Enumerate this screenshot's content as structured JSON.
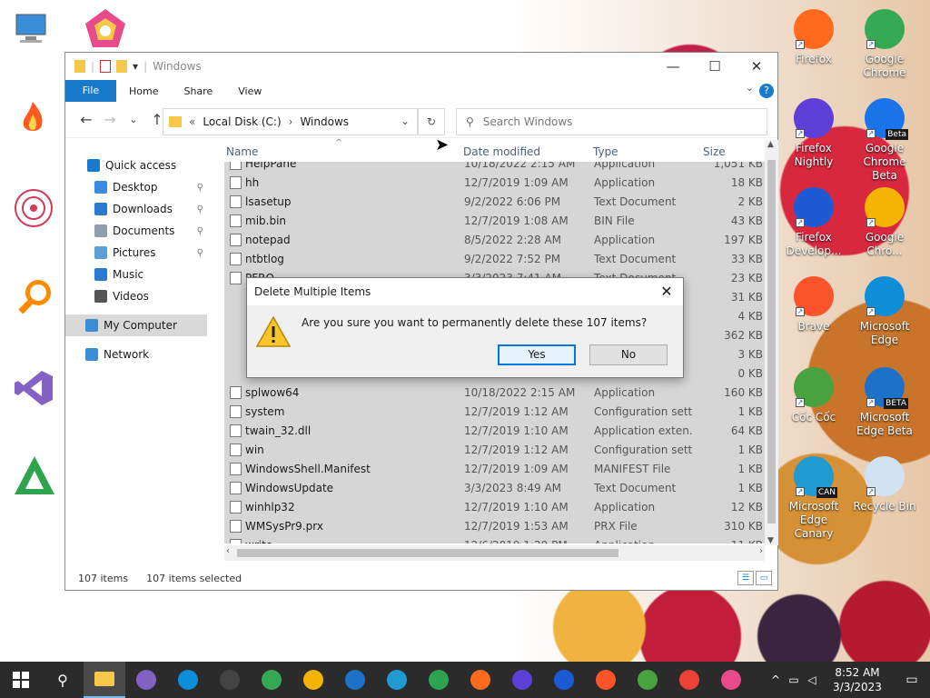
{
  "desktop": {
    "right_icons": [
      {
        "label": "Firefox",
        "color": "#ff6a1f"
      },
      {
        "label": "Google Chrome",
        "color": "#34a853"
      },
      {
        "label": "Firefox Nightly",
        "color": "#5b3fd6"
      },
      {
        "label": "Google Chrome Beta",
        "color": "#1a73e8",
        "badge": "Beta"
      },
      {
        "label": "Firefox Develop...",
        "color": "#1d5bd6"
      },
      {
        "label": "Google Chro...",
        "color": "#f5b400"
      },
      {
        "label": "Brave",
        "color": "#fb542b"
      },
      {
        "label": "Microsoft Edge",
        "color": "#0c8fd8"
      },
      {
        "label": "Cốc Cốc",
        "color": "#47a23f"
      },
      {
        "label": "Microsoft Edge Beta",
        "color": "#1c72c9",
        "badge": "BETA"
      },
      {
        "label": "Microsoft Edge Canary",
        "color": "#1f9bd1",
        "badge": "CAN"
      },
      {
        "label": "Recycle Bin",
        "color": "#cfe3f5"
      }
    ]
  },
  "explorer": {
    "title": "Windows",
    "ribbon": {
      "file": "File",
      "tabs": [
        "Home",
        "Share",
        "View"
      ],
      "help": "?"
    },
    "address": {
      "prefix": "«",
      "parts": [
        "Local Disk (C:)",
        "Windows"
      ]
    },
    "search_placeholder": "Search Windows",
    "nav": [
      {
        "label": "Quick access",
        "color": "#1979ca",
        "pinned": false
      },
      {
        "label": "Desktop",
        "color": "#3b8be0",
        "pinned": true
      },
      {
        "label": "Downloads",
        "color": "#2a7ad0",
        "pinned": true
      },
      {
        "label": "Documents",
        "color": "#8f9db0",
        "pinned": true
      },
      {
        "label": "Pictures",
        "color": "#5aa0d8",
        "pinned": true
      },
      {
        "label": "Music",
        "color": "#2a7ad0",
        "pinned": false
      },
      {
        "label": "Videos",
        "color": "#555555",
        "pinned": false
      },
      {
        "label": "My Computer",
        "color": "#3a8ed8",
        "pinned": false
      },
      {
        "label": "Network",
        "color": "#3a8ed8",
        "pinned": false
      }
    ],
    "columns": {
      "name": "Name",
      "date": "Date modified",
      "type": "Type",
      "size": "Size"
    },
    "files": [
      {
        "name": "HelpPane",
        "date": "10/18/2022 2:15 AM",
        "type": "Application",
        "size": "1,051 KB"
      },
      {
        "name": "hh",
        "date": "12/7/2019 1:09 AM",
        "type": "Application",
        "size": "18 KB"
      },
      {
        "name": "lsasetup",
        "date": "9/2/2022 6:06 PM",
        "type": "Text Document",
        "size": "2 KB"
      },
      {
        "name": "mib.bin",
        "date": "12/7/2019 1:08 AM",
        "type": "BIN File",
        "size": "43 KB"
      },
      {
        "name": "notepad",
        "date": "8/5/2022 2:28 AM",
        "type": "Application",
        "size": "197 KB"
      },
      {
        "name": "ntbtlog",
        "date": "9/2/2022 7:52 PM",
        "type": "Text Document",
        "size": "33 KB"
      },
      {
        "name": "PFRO",
        "date": "3/3/2023 7:41 AM",
        "type": "Text Document",
        "size": "23 KB"
      },
      {
        "name": "",
        "date": "",
        "type": "",
        "size": "31 KB"
      },
      {
        "name": "",
        "date": "",
        "type": "",
        "size": "4 KB"
      },
      {
        "name": "",
        "date": "",
        "type": "",
        "size": "362 KB"
      },
      {
        "name": "",
        "date": "",
        "type": "",
        "size": "3 KB"
      },
      {
        "name": "",
        "date": "",
        "type": "",
        "size": "0 KB"
      },
      {
        "name": "splwow64",
        "date": "10/18/2022 2:15 AM",
        "type": "Application",
        "size": "160 KB"
      },
      {
        "name": "system",
        "date": "12/7/2019 1:12 AM",
        "type": "Configuration sett...",
        "size": "1 KB"
      },
      {
        "name": "twain_32.dll",
        "date": "12/7/2019 1:10 AM",
        "type": "Application exten...",
        "size": "64 KB"
      },
      {
        "name": "win",
        "date": "12/7/2019 1:12 AM",
        "type": "Configuration sett...",
        "size": "1 KB"
      },
      {
        "name": "WindowsShell.Manifest",
        "date": "12/7/2019 1:09 AM",
        "type": "MANIFEST File",
        "size": "1 KB"
      },
      {
        "name": "WindowsUpdate",
        "date": "3/3/2023 8:49 AM",
        "type": "Text Document",
        "size": "1 KB"
      },
      {
        "name": "winhlp32",
        "date": "12/7/2019 1:10 AM",
        "type": "Application",
        "size": "12 KB"
      },
      {
        "name": "WMSysPr9.prx",
        "date": "12/7/2019 1:53 AM",
        "type": "PRX File",
        "size": "310 KB"
      },
      {
        "name": "write",
        "date": "12/6/2019 1:29 PM",
        "type": "Application",
        "size": "11 KB"
      }
    ],
    "status": {
      "count": "107 items",
      "selected": "107 items selected"
    }
  },
  "dialog": {
    "title": "Delete Multiple Items",
    "message": "Are you sure you want to permanently delete these 107 items?",
    "yes": "Yes",
    "no": "No"
  },
  "taskbar": {
    "apps": [
      {
        "name": "file-explorer",
        "color": "#f5c84a",
        "active": true
      },
      {
        "name": "visual-studio",
        "color": "#8661c5",
        "active": false
      },
      {
        "name": "edge",
        "color": "#0c8fd8",
        "active": false
      },
      {
        "name": "obs",
        "color": "#444444",
        "active": false
      },
      {
        "name": "chrome-beta",
        "color": "#34a853",
        "active": false
      },
      {
        "name": "chrome-canary",
        "color": "#f5b400",
        "active": false
      },
      {
        "name": "edge-beta",
        "color": "#1c72c9",
        "active": false
      },
      {
        "name": "edge-canary",
        "color": "#1f9bd1",
        "active": false
      },
      {
        "name": "pdf-app",
        "color": "#2ea44f",
        "active": false
      },
      {
        "name": "firefox",
        "color": "#ff6a1f",
        "active": false
      },
      {
        "name": "firefox-nightly",
        "color": "#5b3fd6",
        "active": false
      },
      {
        "name": "firefox-dev",
        "color": "#1d5bd6",
        "active": false
      },
      {
        "name": "brave",
        "color": "#fb542b",
        "active": false
      },
      {
        "name": "coccoc",
        "color": "#47a23f",
        "active": false
      },
      {
        "name": "chrome",
        "color": "#ea4335",
        "active": false
      },
      {
        "name": "polychromatic",
        "color": "#e84a8a",
        "active": false
      }
    ],
    "time": "8:52 AM",
    "date": "3/3/2023"
  }
}
